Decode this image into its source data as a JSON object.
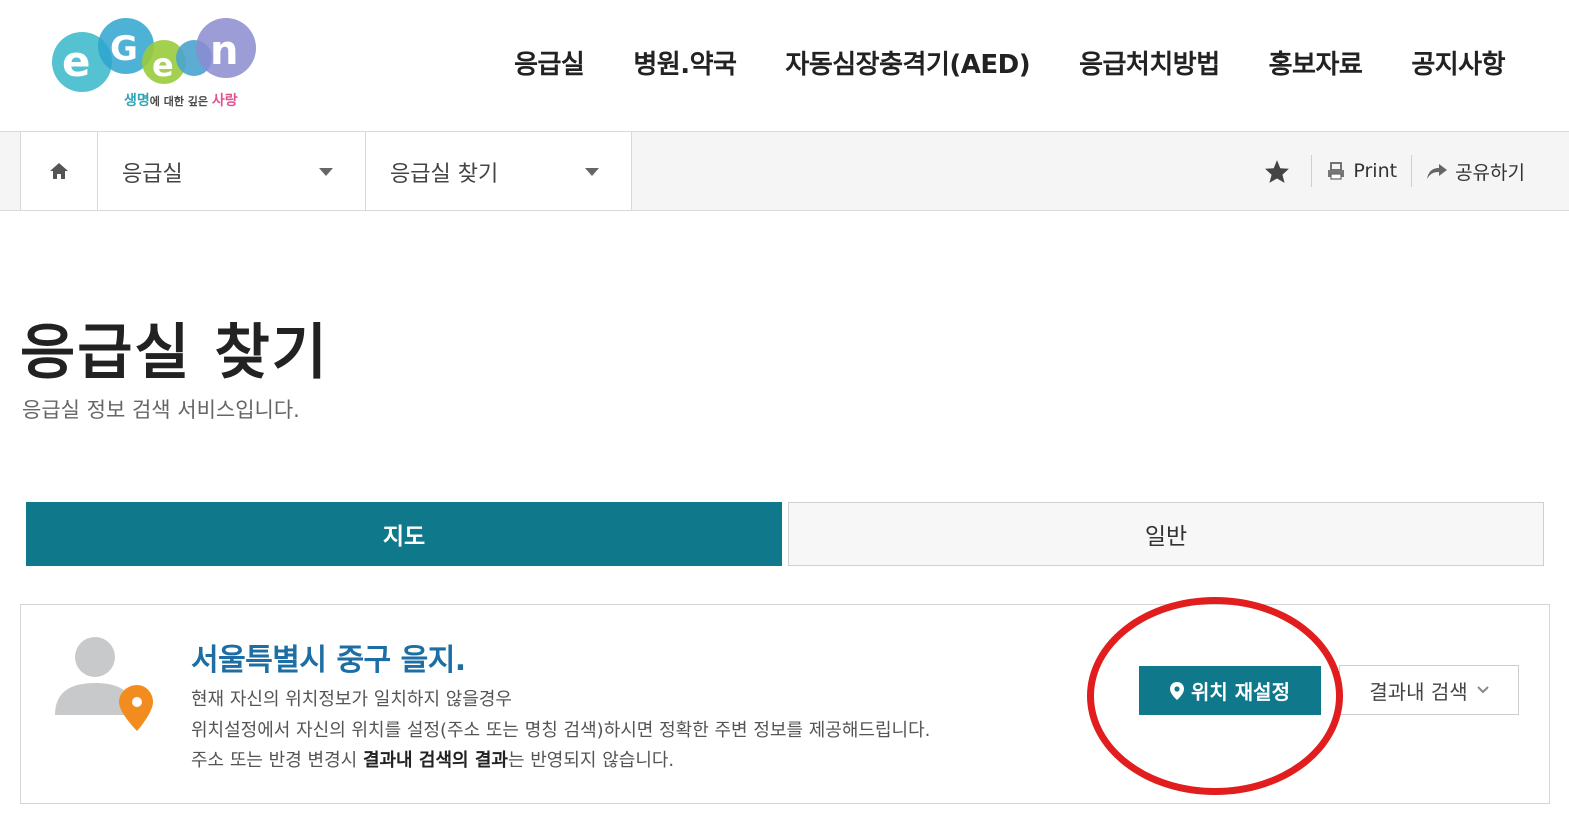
{
  "header": {
    "logo_tagline": {
      "part1": "생명",
      "part2": "에 대한 깊은 ",
      "part3": "사랑"
    },
    "nav": [
      {
        "label": "응급실"
      },
      {
        "label": "병원.약국"
      },
      {
        "label": "자동심장충격기(AED)"
      },
      {
        "label": "응급처치방법"
      },
      {
        "label": "홍보자료"
      },
      {
        "label": "공지사항"
      }
    ]
  },
  "location_bar": {
    "home_icon": "home-icon",
    "depth1": "응급실",
    "depth2": "응급실 찾기",
    "utils": {
      "bookmark_icon": "star-icon",
      "print_label": "Print",
      "share_label": "공유하기"
    }
  },
  "page": {
    "title": "응급실 찾기",
    "description": "응급실 정보 검색 서비스입니다."
  },
  "tabs": [
    {
      "label": "지도",
      "active": true
    },
    {
      "label": "일반",
      "active": false
    }
  ],
  "location_info": {
    "current_location": "서울특별시 중구 을지.",
    "line1": "현재 자신의 위치정보가 일치하지 않을경우",
    "line2": "위치설정에서 자신의 위치를 설정(주소 또는 명칭 검색)하시면 정확한 주변 정보를 제공해드립니다.",
    "line3_prefix": "주소 또는 반경 변경시 ",
    "line3_bold": "결과내 검색의 결과",
    "line3_suffix": "는 반영되지 않습니다.",
    "reset_button": "위치 재설정",
    "search_in_results_button": "결과내 검색"
  },
  "colors": {
    "accent": "#10788b",
    "link_title": "#1c6ea4",
    "annotation": "#e11d1d",
    "marker": "#f28c1e"
  }
}
